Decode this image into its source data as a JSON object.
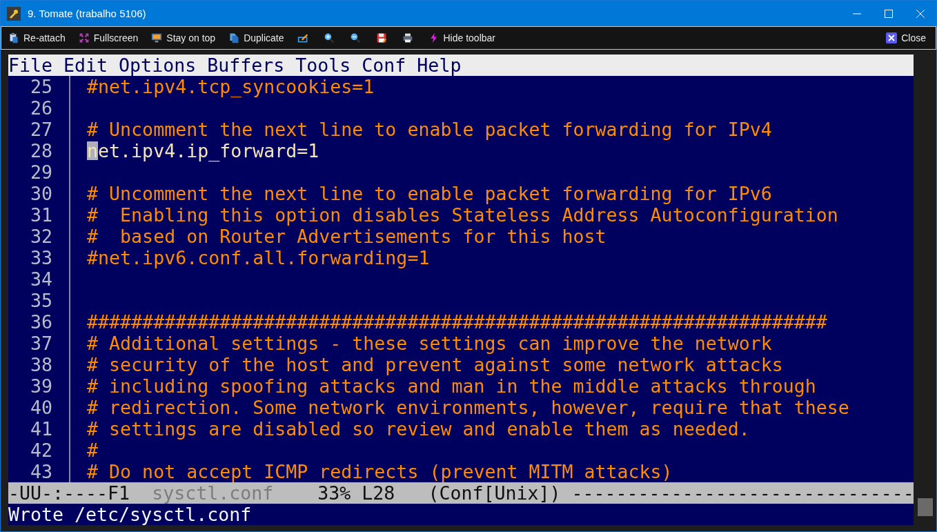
{
  "window": {
    "title": "9. Tomate (trabalho 5106)"
  },
  "toolbar": {
    "items": [
      {
        "kind": "labeled",
        "label": "Re-attach"
      },
      {
        "kind": "labeled",
        "label": "Fullscreen"
      },
      {
        "kind": "labeled",
        "label": "Stay on top"
      },
      {
        "kind": "labeled",
        "label": "Duplicate"
      },
      {
        "kind": "icon"
      },
      {
        "kind": "icon"
      },
      {
        "kind": "icon"
      },
      {
        "kind": "icon"
      },
      {
        "kind": "icon"
      },
      {
        "kind": "labeled",
        "label": "Hide toolbar"
      }
    ],
    "close_button": {
      "label": "Close"
    }
  },
  "menu": [
    "File",
    "Edit",
    "Options",
    "Buffers",
    "Tools",
    "Conf",
    "Help"
  ],
  "lines": [
    {
      "number": "25",
      "text": "#net.ipv4.tcp_syncookies=1",
      "kind": "comment",
      "cursor": false
    },
    {
      "number": "26",
      "kind": "blank",
      "cursor": false
    },
    {
      "number": "27",
      "text": "# Uncomment the next line to enable packet forwarding for IPv4",
      "kind": "comment",
      "cursor": false
    },
    {
      "number": "28",
      "text": "net.ipv4.ip_forward=1",
      "kind": "code",
      "cursor": true
    },
    {
      "number": "29",
      "kind": "blank",
      "cursor": false
    },
    {
      "number": "30",
      "text": "# Uncomment the next line to enable packet forwarding for IPv6",
      "kind": "comment",
      "cursor": false
    },
    {
      "number": "31",
      "text": "#  Enabling this option disables Stateless Address Autoconfiguration",
      "kind": "comment",
      "cursor": false
    },
    {
      "number": "32",
      "text": "#  based on Router Advertisements for this host",
      "kind": "comment",
      "cursor": false
    },
    {
      "number": "33",
      "text": "#net.ipv6.conf.all.forwarding=1",
      "kind": "comment",
      "cursor": false
    },
    {
      "number": "34",
      "kind": "blank",
      "cursor": false
    },
    {
      "number": "35",
      "kind": "blank",
      "cursor": false
    },
    {
      "number": "36",
      "text": "###################################################################",
      "kind": "comment",
      "cursor": false
    },
    {
      "number": "37",
      "text": "# Additional settings - these settings can improve the network",
      "kind": "comment",
      "cursor": false
    },
    {
      "number": "38",
      "text": "# security of the host and prevent against some network attacks",
      "kind": "comment",
      "cursor": false
    },
    {
      "number": "39",
      "text": "# including spoofing attacks and man in the middle attacks through",
      "kind": "comment",
      "cursor": false
    },
    {
      "number": "40",
      "text": "# redirection. Some network environments, however, require that these",
      "kind": "comment",
      "cursor": false
    },
    {
      "number": "41",
      "text": "# settings are disabled so review and enable them as needed.",
      "kind": "comment",
      "cursor": false
    },
    {
      "number": "42",
      "text": "#",
      "kind": "comment",
      "cursor": false
    },
    {
      "number": "43",
      "text": "# Do not accept ICMP redirects (prevent MITM attacks)",
      "kind": "comment",
      "cursor": false
    }
  ],
  "mode_line": {
    "status": "-UU-:----F1",
    "buffer": "sysctl.conf",
    "position": "33% L28",
    "mode": "(Conf[Unix])",
    "fill": "-------------------------------"
  },
  "echo_area": "Wrote /etc/sysctl.conf"
}
